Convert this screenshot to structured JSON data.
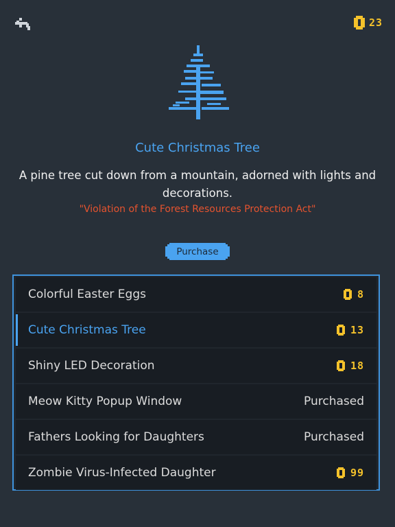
{
  "header": {
    "back_icon": "back-arrow-icon",
    "coin_icon": "coin-icon",
    "coin_balance": "23"
  },
  "detail": {
    "item_icon": "christmas-tree-icon",
    "title": "Cute Christmas Tree",
    "description": "A pine tree cut down from a mountain, adorned with lights and decorations.",
    "quote": "\"Violation of the Forest Resources Protection Act\"",
    "purchase_label": "Purchase"
  },
  "colors": {
    "accent": "#4aa3f0",
    "coin": "#f5c22b",
    "quote": "#e5532f",
    "background": "#283039"
  },
  "shop": {
    "items": [
      {
        "name": "Colorful Easter Eggs",
        "price": "8",
        "status": ""
      },
      {
        "name": "Cute Christmas Tree",
        "price": "13",
        "status": ""
      },
      {
        "name": "Shiny LED Decoration",
        "price": "18",
        "status": ""
      },
      {
        "name": "Meow Kitty Popup Window",
        "price": "",
        "status": "Purchased"
      },
      {
        "name": "Fathers Looking for Daughters",
        "price": "",
        "status": "Purchased"
      },
      {
        "name": "Zombie Virus-Infected Daughter",
        "price": "99",
        "status": ""
      }
    ]
  }
}
